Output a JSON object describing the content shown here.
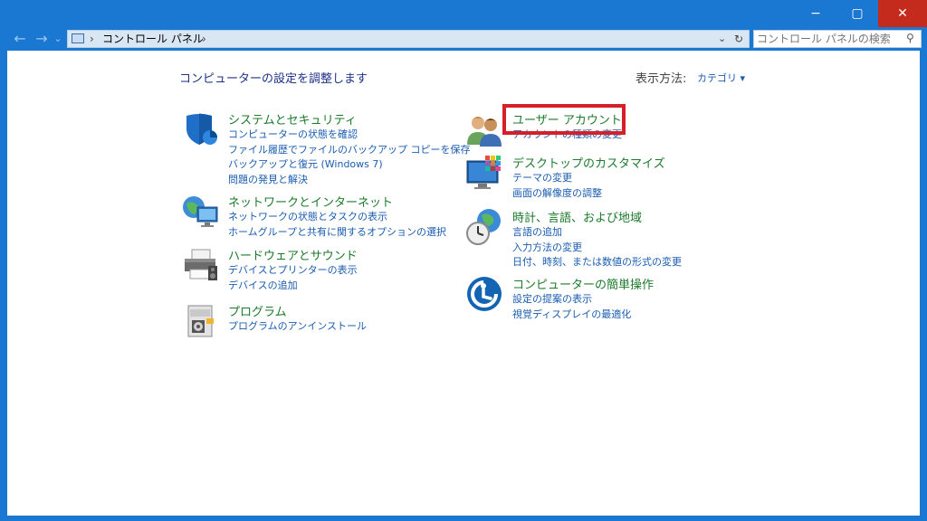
{
  "window": {
    "controls": {
      "minimize": "−",
      "maximize": "▢",
      "close": "✕"
    }
  },
  "address_bar": {
    "back_icon": "←",
    "forward_icon": "→",
    "recent_icon": "⌄",
    "separator": "›",
    "breadcrumb": "コントロール パネル",
    "dropdown_icon": "⌄",
    "refresh_icon": "↻"
  },
  "search": {
    "placeholder": "コントロール パネルの検索",
    "icon": "⚲"
  },
  "main": {
    "heading": "コンピューターの設定を調整します",
    "view_label": "表示方法:",
    "view_value": "カテゴリ ▾"
  },
  "categories_left": [
    {
      "title": "システムとセキュリティ",
      "icon": "shield-icon",
      "links": [
        "コンピューターの状態を確認",
        "ファイル履歴でファイルのバックアップ コピーを保存",
        "バックアップと復元 (Windows 7)",
        "問題の発見と解決"
      ]
    },
    {
      "title": "ネットワークとインターネット",
      "icon": "network-icon",
      "links": [
        "ネットワークの状態とタスクの表示",
        "ホームグループと共有に関するオプションの選択"
      ]
    },
    {
      "title": "ハードウェアとサウンド",
      "icon": "printer-icon",
      "links": [
        "デバイスとプリンターの表示",
        "デバイスの追加"
      ]
    },
    {
      "title": "プログラム",
      "icon": "programs-icon",
      "links": [
        "プログラムのアンインストール"
      ]
    }
  ],
  "categories_right": [
    {
      "title": "ユーザー アカウント",
      "icon": "users-icon",
      "links": [
        "アカウントの種類の変更"
      ]
    },
    {
      "title": "デスクトップのカスタマイズ",
      "icon": "desktop-icon",
      "links": [
        "テーマの変更",
        "画面の解像度の調整"
      ]
    },
    {
      "title": "時計、言語、および地域",
      "icon": "clock-globe-icon",
      "links": [
        "言語の追加",
        "入力方法の変更",
        "日付、時刻、または数値の形式の変更"
      ]
    },
    {
      "title": "コンピューターの簡単操作",
      "icon": "ease-of-access-icon",
      "links": [
        "設定の提案の表示",
        "視覚ディスプレイの最適化"
      ]
    }
  ],
  "colors": {
    "frame": "#1a78d2",
    "category_title": "#1c7a2b",
    "link": "#1a5cb0",
    "highlight": "#d5202a"
  }
}
